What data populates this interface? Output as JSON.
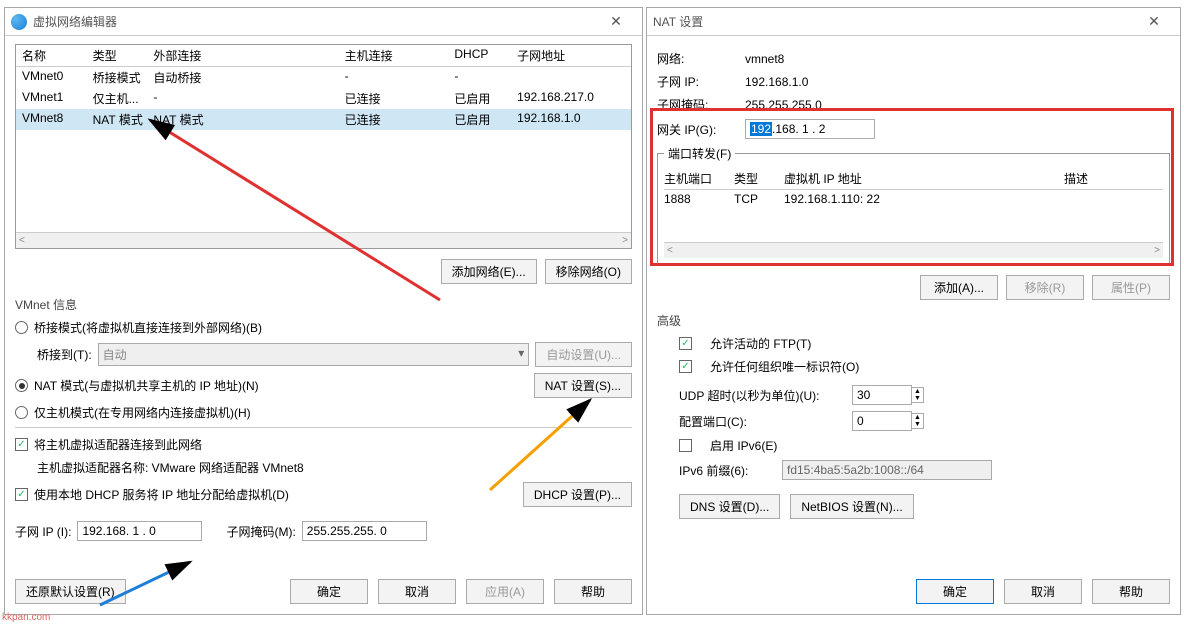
{
  "left": {
    "title": "虚拟网络编辑器",
    "columns": {
      "name": "名称",
      "type": "类型",
      "ext": "外部连接",
      "host": "主机连接",
      "dhcp": "DHCP",
      "subnet": "子网地址"
    },
    "rows": [
      {
        "name": "VMnet0",
        "type": "桥接模式",
        "ext": "自动桥接",
        "host": "-",
        "dhcp": "-",
        "subnet": ""
      },
      {
        "name": "VMnet1",
        "type": "仅主机...",
        "ext": "-",
        "host": "已连接",
        "dhcp": "已启用",
        "subnet": "192.168.217.0"
      },
      {
        "name": "VMnet8",
        "type": "NAT 模式",
        "ext": "NAT 模式",
        "host": "已连接",
        "dhcp": "已启用",
        "subnet": "192.168.1.0"
      }
    ],
    "add_net": "添加网络(E)...",
    "remove_net": "移除网络(O)",
    "vminfo": "VMnet 信息",
    "radio_bridge": "桥接模式(将虚拟机直接连接到外部网络)(B)",
    "bridge_to": "桥接到(T):",
    "auto": "自动",
    "auto_set": "自动设置(U)...",
    "radio_nat": "NAT 模式(与虚拟机共享主机的 IP 地址)(N)",
    "nat_set": "NAT 设置(S)...",
    "radio_host": "仅主机模式(在专用网络内连接虚拟机)(H)",
    "chk_adapter": "将主机虚拟适配器连接到此网络",
    "adapter_name": "主机虚拟适配器名称: VMware 网络适配器 VMnet8",
    "chk_dhcp": "使用本地 DHCP 服务将 IP 地址分配给虚拟机(D)",
    "dhcp_set": "DHCP 设置(P)...",
    "subnet_ip_label": "子网 IP (I):",
    "subnet_ip": "192.168. 1 . 0",
    "subnet_mask_label": "子网掩码(M):",
    "subnet_mask": "255.255.255. 0",
    "restore": "还原默认设置(R)",
    "ok": "确定",
    "cancel": "取消",
    "apply": "应用(A)",
    "help": "帮助"
  },
  "right": {
    "title": "NAT 设置",
    "net_label": "网络:",
    "net": "vmnet8",
    "subnet_ip_label": "子网 IP:",
    "subnet_ip": "192.168.1.0",
    "mask_label": "子网掩码:",
    "mask": "255.255.255.0",
    "gw_label": "网关 IP(G):",
    "gw_sel": "192",
    "gw_rest": ".168. 1 . 2",
    "pf_label": "端口转发(F)",
    "pf_cols": {
      "port": "主机端口",
      "type": "类型",
      "ip": "虚拟机 IP 地址",
      "desc": "描述"
    },
    "pf_rows": [
      {
        "port": "1888",
        "type": "TCP",
        "ip": "192.168.1.110: 22",
        "desc": ""
      }
    ],
    "add": "添加(A)...",
    "remove": "移除(R)",
    "props": "属性(P)",
    "adv": "高级",
    "chk_ftp": "允许活动的 FTP(T)",
    "chk_org": "允许任何组织唯一标识符(O)",
    "udp_label": "UDP 超时(以秒为单位)(U):",
    "udp_val": "30",
    "cfg_port_label": "配置端口(C):",
    "cfg_port_val": "0",
    "chk_ipv6": "启用 IPv6(E)",
    "ipv6_prefix_label": "IPv6 前缀(6):",
    "ipv6_prefix": "fd15:4ba5:5a2b:1008::/64",
    "dns": "DNS 设置(D)...",
    "netbios": "NetBIOS 设置(N)...",
    "ok": "确定",
    "cancel": "取消",
    "help": "帮助"
  },
  "watermark": "kkpan.com"
}
